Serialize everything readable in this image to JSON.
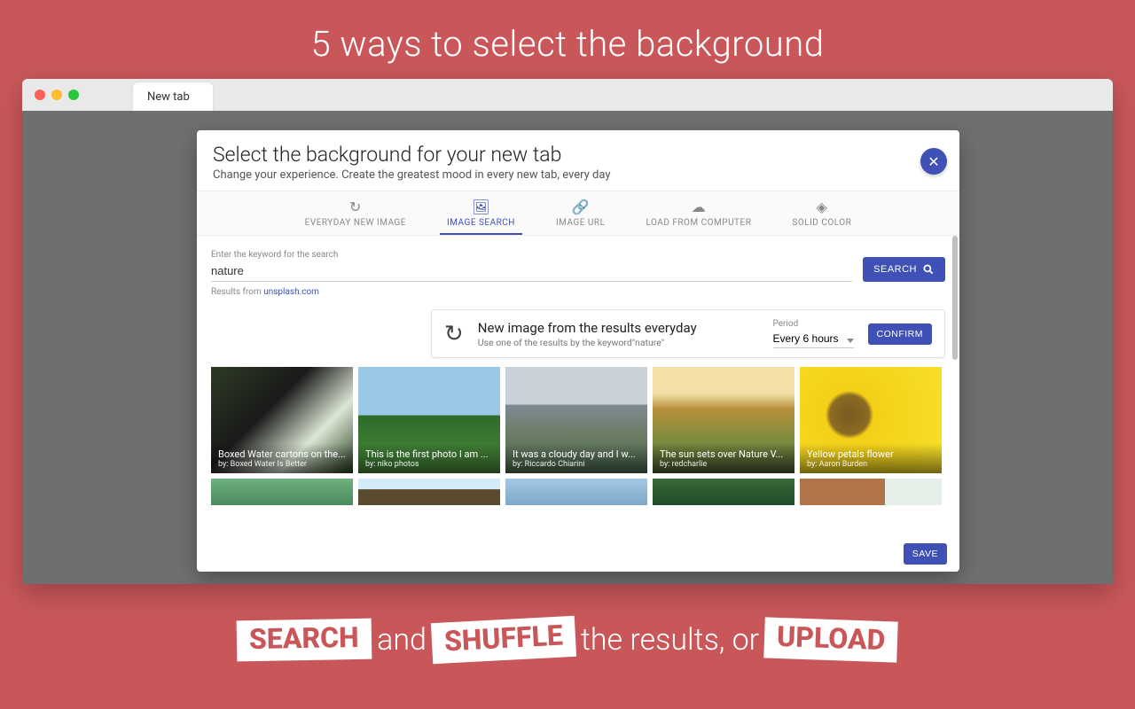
{
  "promo": {
    "heading": "5 ways to select the background",
    "tagline_parts": {
      "w1": "SEARCH",
      "t1": "and",
      "w2": "SHUFFLE",
      "t2": "the results, or",
      "w3": "UPLOAD"
    }
  },
  "browser": {
    "tab_label": "New tab"
  },
  "dialog": {
    "title": "Select the background for your new tab",
    "subtitle": "Change your experience. Create the greatest mood in every new tab, every day",
    "tabs": [
      {
        "label": "EVERYDAY NEW IMAGE",
        "glyph": "↻",
        "active": false
      },
      {
        "label": "IMAGE SEARCH",
        "glyph": "🖼",
        "active": true
      },
      {
        "label": "IMAGE URL",
        "glyph": "🔗",
        "active": false
      },
      {
        "label": "LOAD FROM COMPUTER",
        "glyph": "☁",
        "active": false
      },
      {
        "label": "SOLID COLOR",
        "glyph": "◈",
        "active": false
      }
    ],
    "search": {
      "field_label": "Enter the keyword for the search",
      "value": "nature",
      "button": "SEARCH",
      "results_prefix": "Results from ",
      "results_link": "unsplash.com"
    },
    "everyday": {
      "title": "New image from the results everyday",
      "subtitle": "Use one of the results by the keyword\"nature\"",
      "period_label": "Period",
      "period_value": "Every 6 hours",
      "confirm": "CONFIRM"
    },
    "gallery_row1": [
      {
        "caption": "Boxed Water cartons on the...",
        "by": "by: Boxed Water Is Better",
        "css": "background:linear-gradient(135deg,#2d3a24 0%,#1a1a1a 40%,#dce7d5 70%,#233d1e 100%)"
      },
      {
        "caption": "This is the first photo I am ...",
        "by": "by: niko photos",
        "css": "background:linear-gradient(#9cc8e8 45%,#2f6b2a 46%,#4a8a3c 100%)"
      },
      {
        "caption": "It was a cloudy day and I w...",
        "by": "by: Riccardo Chiarini",
        "css": "background:linear-gradient(#c8d2d8 35%,#7d8a92 36%,#6b7c63 65%,#4a6b50 100%)"
      },
      {
        "caption": "The sun sets over Nature V...",
        "by": "by: redcharlie",
        "css": "background:linear-gradient(#f4dfa8 25%,#b58f38 40%,#7a8c3f 70%,#4a5a32 100%)"
      },
      {
        "caption": "Yellow petals flower",
        "by": "by: Aaron Burden",
        "css": "background:radial-gradient(circle at 35% 45%,#7a5a1f 0%,#8c6b22 18%,#f4d018 22%,#f6e02a 100%)"
      }
    ],
    "gallery_row2_css": [
      "background:linear-gradient(#6fb07d,#4a8a60)",
      "background:linear-gradient(#d4ecf7 40%,#5a4a2e 41%)",
      "background:linear-gradient(#a3c9e6,#7ea8c8)",
      "background:linear-gradient(#3a6b3a,#1f4a28)",
      "background:linear-gradient(90deg,#b07448 60%,#e5efe8 60%)"
    ],
    "save": "SAVE"
  }
}
